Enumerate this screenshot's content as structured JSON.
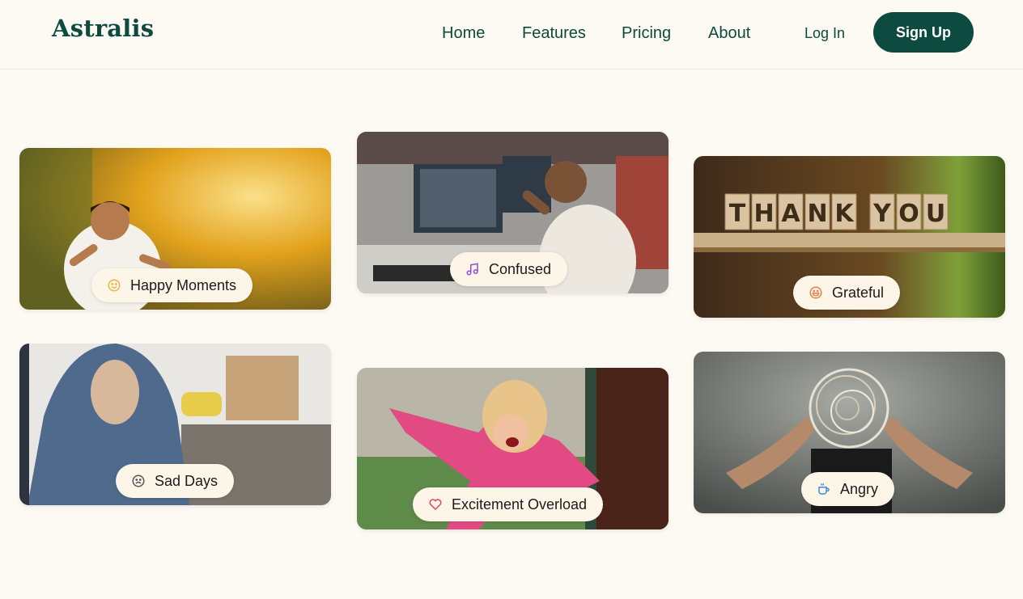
{
  "brand": {
    "name": "Astralis"
  },
  "nav": {
    "items": [
      {
        "label": "Home"
      },
      {
        "label": "Features"
      },
      {
        "label": "Pricing"
      },
      {
        "label": "About"
      }
    ],
    "login_label": "Log In",
    "signup_label": "Sign Up"
  },
  "colors": {
    "primary": "#0d4a3f",
    "background": "#fdf9f3",
    "pill_background": "#fdf5e7"
  },
  "mood_cards": [
    {
      "label": "Happy Moments",
      "icon": "smile-icon",
      "icon_color": "#e9b64a"
    },
    {
      "label": "Confused",
      "icon": "music-note-icon",
      "icon_color": "#8a4fd6"
    },
    {
      "label": "Grateful",
      "icon": "grin-icon",
      "icon_color": "#e3804a"
    },
    {
      "label": "Sad Days",
      "icon": "frown-icon",
      "icon_color": "#555555"
    },
    {
      "label": "Excitement Overload",
      "icon": "heart-icon",
      "icon_color": "#e0446a"
    },
    {
      "label": "Angry",
      "icon": "coffee-cup-icon",
      "icon_color": "#3f8fd8"
    }
  ],
  "images": {
    "grateful_sign_text": "THANK YOU"
  }
}
